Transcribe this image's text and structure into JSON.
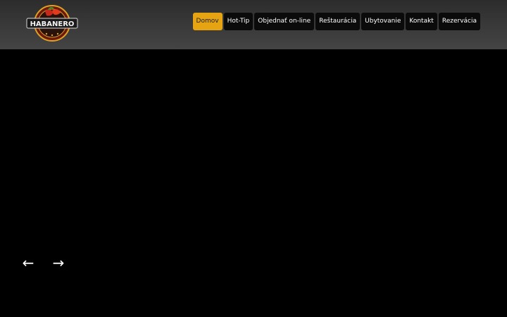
{
  "brand": {
    "logo_text": "HABANERO",
    "colors": {
      "header_bg": "#3a3a3a",
      "nav_active": "#e6a413",
      "nav_bg": "#0b0b0b",
      "page_bg": "#000000"
    }
  },
  "nav": {
    "items": [
      {
        "label": "Domov",
        "active": true
      },
      {
        "label": "Hot-Tip",
        "active": false
      },
      {
        "label": "Objednať on-line",
        "active": false
      },
      {
        "label": "Reštaurácia",
        "active": false
      },
      {
        "label": "Ubytovanie",
        "active": false
      },
      {
        "label": "Kontakt",
        "active": false
      },
      {
        "label": "Rezervácia",
        "active": false
      }
    ]
  },
  "slider": {
    "prev_icon": "arrow-left-icon",
    "next_icon": "arrow-right-icon",
    "prev_glyph": "←",
    "next_glyph": "→"
  }
}
